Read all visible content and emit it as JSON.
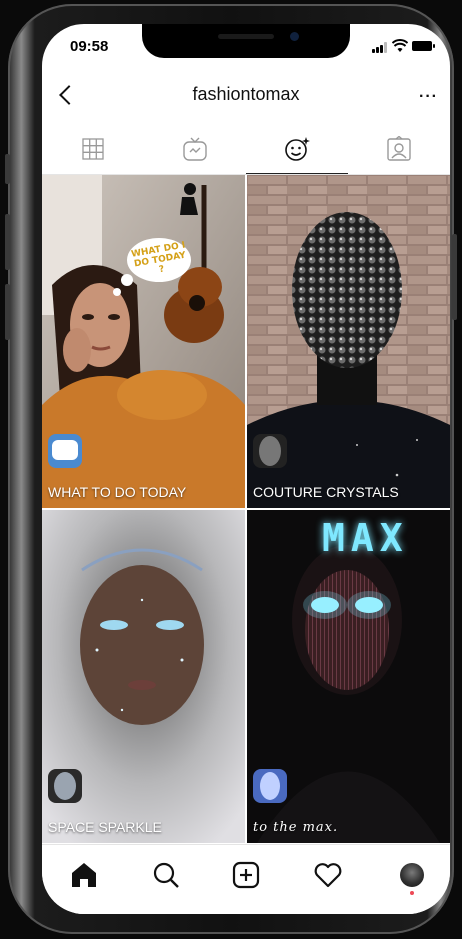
{
  "status_bar": {
    "time": "09:58"
  },
  "header": {
    "username": "fashiontomax",
    "more_label": "···"
  },
  "tabs": [
    {
      "icon": "grid-icon",
      "active": false
    },
    {
      "icon": "igtv-icon",
      "active": false
    },
    {
      "icon": "effects-icon",
      "active": true
    },
    {
      "icon": "tagged-icon",
      "active": false
    }
  ],
  "effects": [
    {
      "name": "WHAT TO DO TODAY",
      "bubble_text": "WHAT DO I DO TODAY ?"
    },
    {
      "name": "COUTURE CRYSTALS"
    },
    {
      "name": "SPACE SPARKLE"
    },
    {
      "name": "to the max.",
      "overlay_text": "MAX"
    }
  ],
  "bottom_nav": [
    "home-icon",
    "search-icon",
    "new-post-icon",
    "activity-icon",
    "profile-avatar"
  ],
  "colors": {
    "accent_dot": "#ed4956",
    "max_glow": "#7fe8ff"
  }
}
